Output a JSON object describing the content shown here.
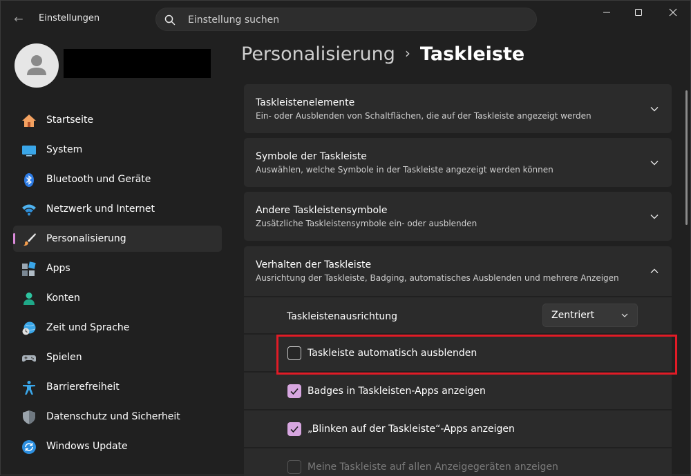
{
  "window": {
    "app_title": "Einstellungen",
    "search_placeholder": "Einstellung suchen",
    "controls": [
      "minimize-icon",
      "maximize-icon",
      "close-icon"
    ]
  },
  "sidebar": {
    "items": [
      {
        "label": "Startseite",
        "icon": "home-icon",
        "active": false
      },
      {
        "label": "System",
        "icon": "monitor-icon",
        "active": false
      },
      {
        "label": "Bluetooth und Geräte",
        "icon": "bluetooth-icon",
        "active": false
      },
      {
        "label": "Netzwerk und Internet",
        "icon": "wifi-icon",
        "active": false
      },
      {
        "label": "Personalisierung",
        "icon": "brush-icon",
        "active": true
      },
      {
        "label": "Apps",
        "icon": "apps-icon",
        "active": false
      },
      {
        "label": "Konten",
        "icon": "person-icon",
        "active": false
      },
      {
        "label": "Zeit und Sprache",
        "icon": "globe-clock-icon",
        "active": false
      },
      {
        "label": "Spielen",
        "icon": "gamepad-icon",
        "active": false
      },
      {
        "label": "Barrierefreiheit",
        "icon": "accessibility-icon",
        "active": false
      },
      {
        "label": "Datenschutz und Sicherheit",
        "icon": "shield-icon",
        "active": false
      },
      {
        "label": "Windows Update",
        "icon": "update-icon",
        "active": false
      }
    ]
  },
  "breadcrumb": {
    "parent": "Personalisierung",
    "separator": "›",
    "current": "Taskleiste"
  },
  "cards": [
    {
      "title": "Taskleistenelemente",
      "subtitle": "Ein- oder Ausblenden von Schaltflächen, die auf der Taskleiste angezeigt werden",
      "expanded": false
    },
    {
      "title": "Symbole der Taskleiste",
      "subtitle": "Auswählen, welche Symbole in der Taskleiste angezeigt werden können",
      "expanded": false
    },
    {
      "title": "Andere Taskleistensymbole",
      "subtitle": "Zusätzliche Taskleistensymbole ein- oder ausblenden",
      "expanded": false
    },
    {
      "title": "Verhalten der Taskleiste",
      "subtitle": "Ausrichtung der Taskleiste, Badging, automatisches Ausblenden und mehrere Anzeigen",
      "expanded": true
    }
  ],
  "behavior": {
    "alignment_label": "Taskleistenausrichtung",
    "alignment_value": "Zentriert",
    "options": [
      {
        "label": "Taskleiste automatisch ausblenden",
        "checked": false,
        "disabled": false
      },
      {
        "label": "Badges in Taskleisten-Apps anzeigen",
        "checked": true,
        "disabled": false
      },
      {
        "label": "„Blinken auf der Taskleiste“-Apps anzeigen",
        "checked": true,
        "disabled": false
      },
      {
        "label": "Meine Taskleiste auf allen Anzeigegeräten anzeigen",
        "checked": false,
        "disabled": true
      }
    ]
  },
  "colors": {
    "accent": "#d7a6e0",
    "highlight": "#e11b26",
    "background": "#202020",
    "card": "#2b2b2b"
  }
}
